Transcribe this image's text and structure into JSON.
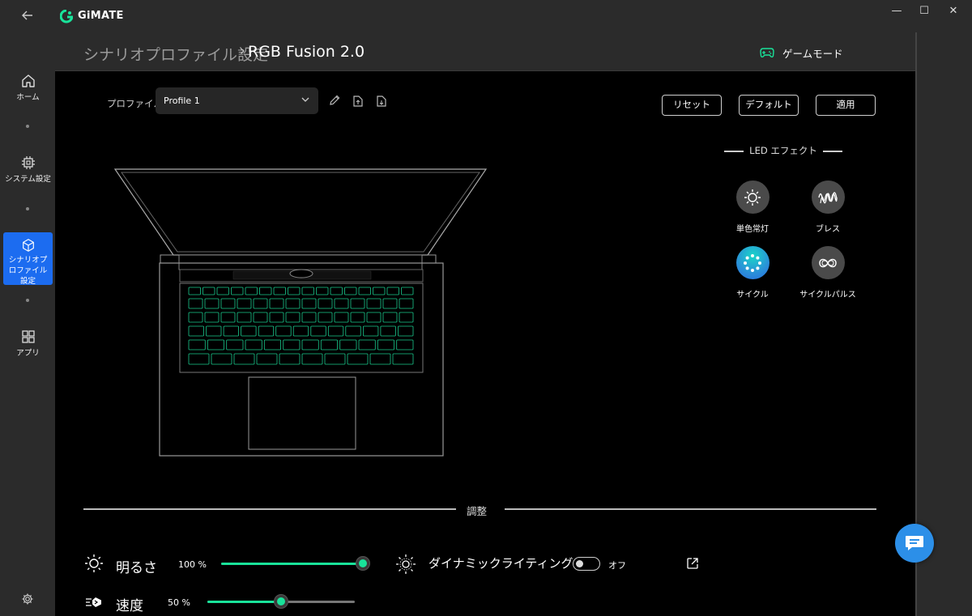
{
  "app": {
    "title": "GiMATE"
  },
  "window": {
    "minimize": "—",
    "maximize": "☐",
    "close": "✕"
  },
  "sidebar": {
    "items": [
      {
        "label": "ホーム",
        "icon": "home-icon"
      },
      {
        "label": "システム設定",
        "icon": "chip-icon"
      },
      {
        "label": "シナリオプロファイル設定",
        "icon": "cube-icon",
        "active": true
      },
      {
        "label": "アプリ",
        "icon": "apps-grid-icon"
      }
    ],
    "settings_icon": "gear-icon"
  },
  "header": {
    "breadcrumb_parent": "シナリオプロファイル設定",
    "breadcrumb_separator": "›",
    "breadcrumb_current": "RGB Fusion 2.0",
    "game_mode_label": "ゲームモード"
  },
  "profile": {
    "label": "プロファイル",
    "selected": "Profile 1"
  },
  "actions": {
    "reset": "リセット",
    "default": "デフォルト",
    "apply": "適用"
  },
  "led_effects": {
    "title": "LED エフェクト",
    "items": [
      {
        "label": "単色常灯",
        "icon": "sun-icon",
        "selected": false
      },
      {
        "label": "ブレス",
        "icon": "wave-icon",
        "selected": false
      },
      {
        "label": "サイクル",
        "icon": "cycle-icon",
        "selected": true
      },
      {
        "label": "サイクルパルス",
        "icon": "infinity-icon",
        "selected": false
      }
    ]
  },
  "adjust": {
    "title": "調整",
    "brightness": {
      "label": "明るさ",
      "value_text": "100 %",
      "value": 1.0
    },
    "speed": {
      "label": "速度",
      "value_text": "50 %",
      "value": 0.5
    },
    "dynamic_lighting": {
      "label": "ダイナミックライティング",
      "state_text": "オフ",
      "on": false
    }
  },
  "colors": {
    "accent": "#19e39a",
    "sidebar_active": "#1c6cf0",
    "panel": "#2b2b2b",
    "key_glow": "#19c98c"
  }
}
